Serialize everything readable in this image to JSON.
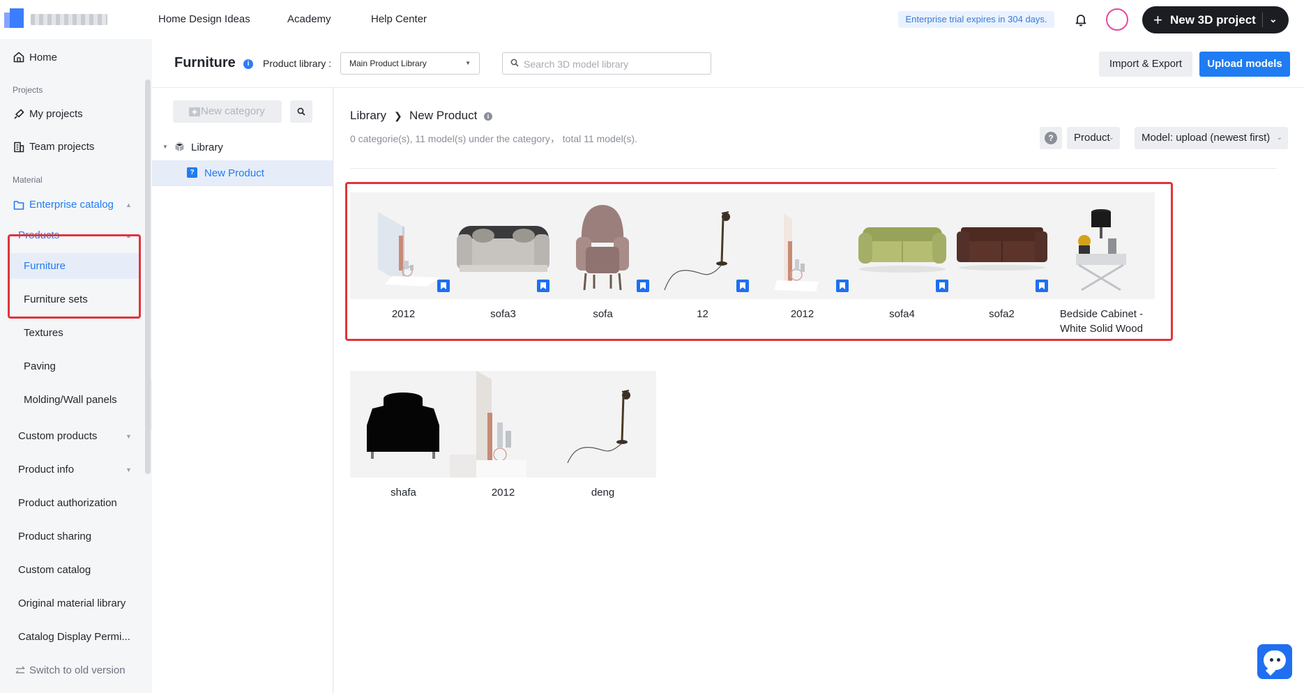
{
  "topnav": {
    "links": [
      "Home Design Ideas",
      "Academy",
      "Help Center"
    ],
    "trial_text": "Enterprise trial expires in 304 days.",
    "new_project_label": "New 3D project"
  },
  "sidebar": {
    "home": "Home",
    "projects_section": "Projects",
    "my_projects": "My projects",
    "team_projects": "Team projects",
    "material_section": "Material",
    "enterprise_catalog": "Enterprise catalog",
    "products": "Products",
    "furniture": "Furniture",
    "furniture_sets": "Furniture sets",
    "textures": "Textures",
    "paving": "Paving",
    "molding": "Molding/Wall panels",
    "custom_products": "Custom products",
    "product_info": "Product info",
    "product_authorization": "Product authorization",
    "product_sharing": "Product sharing",
    "custom_catalog": "Custom catalog",
    "original_material_library": "Original material library",
    "catalog_display": "Catalog Display Permi...",
    "switch_old": "Switch to old version"
  },
  "header": {
    "title": "Furniture",
    "library_label": "Product library :",
    "library_value": "Main Product Library",
    "search_placeholder": "Search 3D model library",
    "import_export": "Import & Export",
    "upload_models": "Upload models"
  },
  "tree": {
    "new_category": "New category",
    "root": "Library",
    "child": "New Product"
  },
  "main": {
    "breadcrumb": [
      "Library",
      "New Product"
    ],
    "summary": "0 categorie(s), 11 model(s) under the category， total 11 model(s).",
    "filter_product": "Product",
    "sort_label": "Model: upload (newest first)",
    "models": [
      {
        "name": "2012",
        "tagged": true
      },
      {
        "name": "sofa3",
        "tagged": true
      },
      {
        "name": "sofa",
        "tagged": true
      },
      {
        "name": "12",
        "tagged": true
      },
      {
        "name": "2012",
        "tagged": true
      },
      {
        "name": "sofa4",
        "tagged": true
      },
      {
        "name": "sofa2",
        "tagged": true
      },
      {
        "name": "Bedside Cabinet - White Solid Wood",
        "tagged": false
      },
      {
        "name": "shafa",
        "tagged": false
      },
      {
        "name": "2012",
        "tagged": false
      },
      {
        "name": "deng",
        "tagged": false
      }
    ]
  },
  "colors": {
    "accent": "#1f7cf2",
    "highlight_box": "#e0343b",
    "selected_bg": "#e6edf9"
  }
}
